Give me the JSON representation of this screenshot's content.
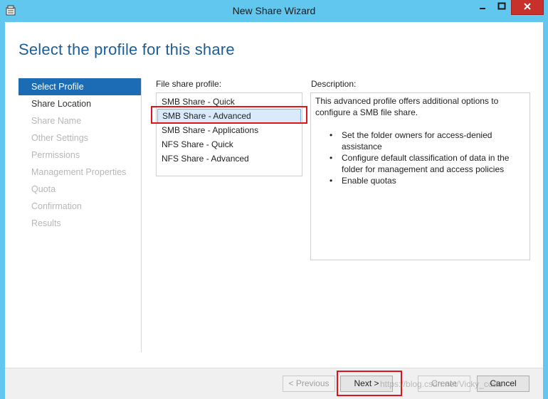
{
  "window": {
    "title": "New Share Wizard"
  },
  "page": {
    "title": "Select the profile for this share"
  },
  "nav": {
    "items": [
      {
        "label": "Select Profile",
        "state": "active"
      },
      {
        "label": "Share Location",
        "state": "enabled"
      },
      {
        "label": "Share Name",
        "state": "disabled"
      },
      {
        "label": "Other Settings",
        "state": "disabled"
      },
      {
        "label": "Permissions",
        "state": "disabled"
      },
      {
        "label": "Management Properties",
        "state": "disabled"
      },
      {
        "label": "Quota",
        "state": "disabled"
      },
      {
        "label": "Confirmation",
        "state": "disabled"
      },
      {
        "label": "Results",
        "state": "disabled"
      }
    ]
  },
  "profiles": {
    "label": "File share profile:",
    "items": [
      "SMB Share - Quick",
      "SMB Share - Advanced",
      "SMB Share - Applications",
      "NFS Share - Quick",
      "NFS Share - Advanced"
    ],
    "selected": "SMB Share - Advanced"
  },
  "description": {
    "label": "Description:",
    "intro": "This advanced profile offers additional options to configure a SMB file share.",
    "bullets": [
      "Set the folder owners for access-denied assistance",
      "Configure default classification of data in the folder for management and access policies",
      "Enable quotas"
    ]
  },
  "buttons": {
    "previous": "< Previous",
    "next": "Next >",
    "create": "Create",
    "cancel": "Cancel"
  },
  "watermark": "https://blog.csdn.net/Vicky_code",
  "colors": {
    "titlebar": "#62c7ee",
    "accent": "#1c6cb5",
    "page_title": "#1e5d94",
    "annotation_red": "#e0141c",
    "close_button": "#c7302b"
  },
  "icons": {
    "app": "share-wizard-icon",
    "minimize": "minimize-icon",
    "maximize": "maximize-icon",
    "close": "close-icon"
  }
}
